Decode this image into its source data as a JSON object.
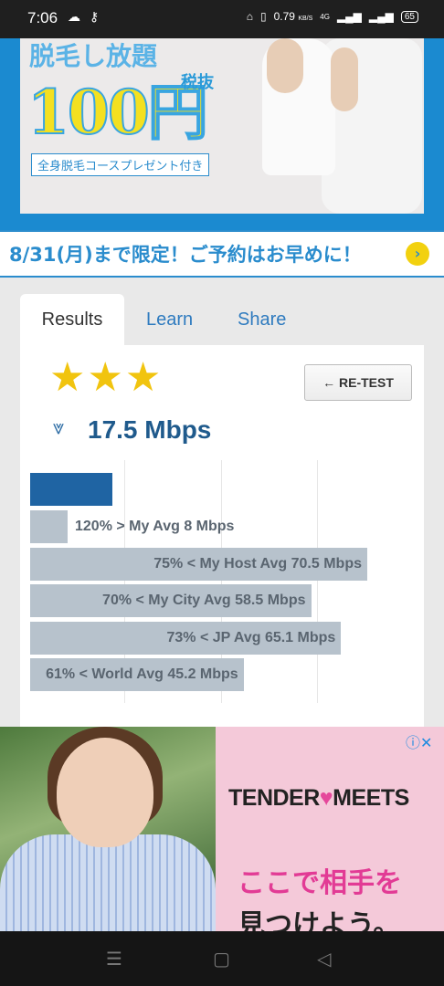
{
  "status_bar": {
    "time": "7:06",
    "network_speed": "0.79",
    "network_unit": "KB/S",
    "net_type": "4G",
    "battery": "65"
  },
  "ad_top": {
    "title": "脱毛し放題",
    "price": "100円",
    "tax_note": "税抜",
    "sub": "全身脱毛コースプレゼント付き",
    "banner": "8/31(月)まで限定！ご予約はお早めに！",
    "arrow": "›"
  },
  "tabs": [
    {
      "label": "Results"
    },
    {
      "label": "Learn"
    },
    {
      "label": "Share"
    }
  ],
  "result": {
    "stars": "★★★",
    "rating": 3,
    "retest_label": "← RE-TEST",
    "speed": "17.5 Mbps",
    "main_bar_fraction": 0.22,
    "comparisons": [
      {
        "label": "120% > My Avg 8 Mbps",
        "fraction": 0.1
      },
      {
        "label": "75% < My Host Avg 70.5 Mbps",
        "fraction": 0.9
      },
      {
        "label": "70% < My City Avg 58.5 Mbps",
        "fraction": 0.75
      },
      {
        "label": "73% < JP Avg 65.1 Mbps",
        "fraction": 0.83
      },
      {
        "label": "61% < World Avg 45.2 Mbps",
        "fraction": 0.57
      }
    ]
  },
  "ad_bottom": {
    "logo_left": "TENDER",
    "logo_right": "MEETS",
    "line1": "ここで相手を",
    "line2": "見つけよう。"
  }
}
